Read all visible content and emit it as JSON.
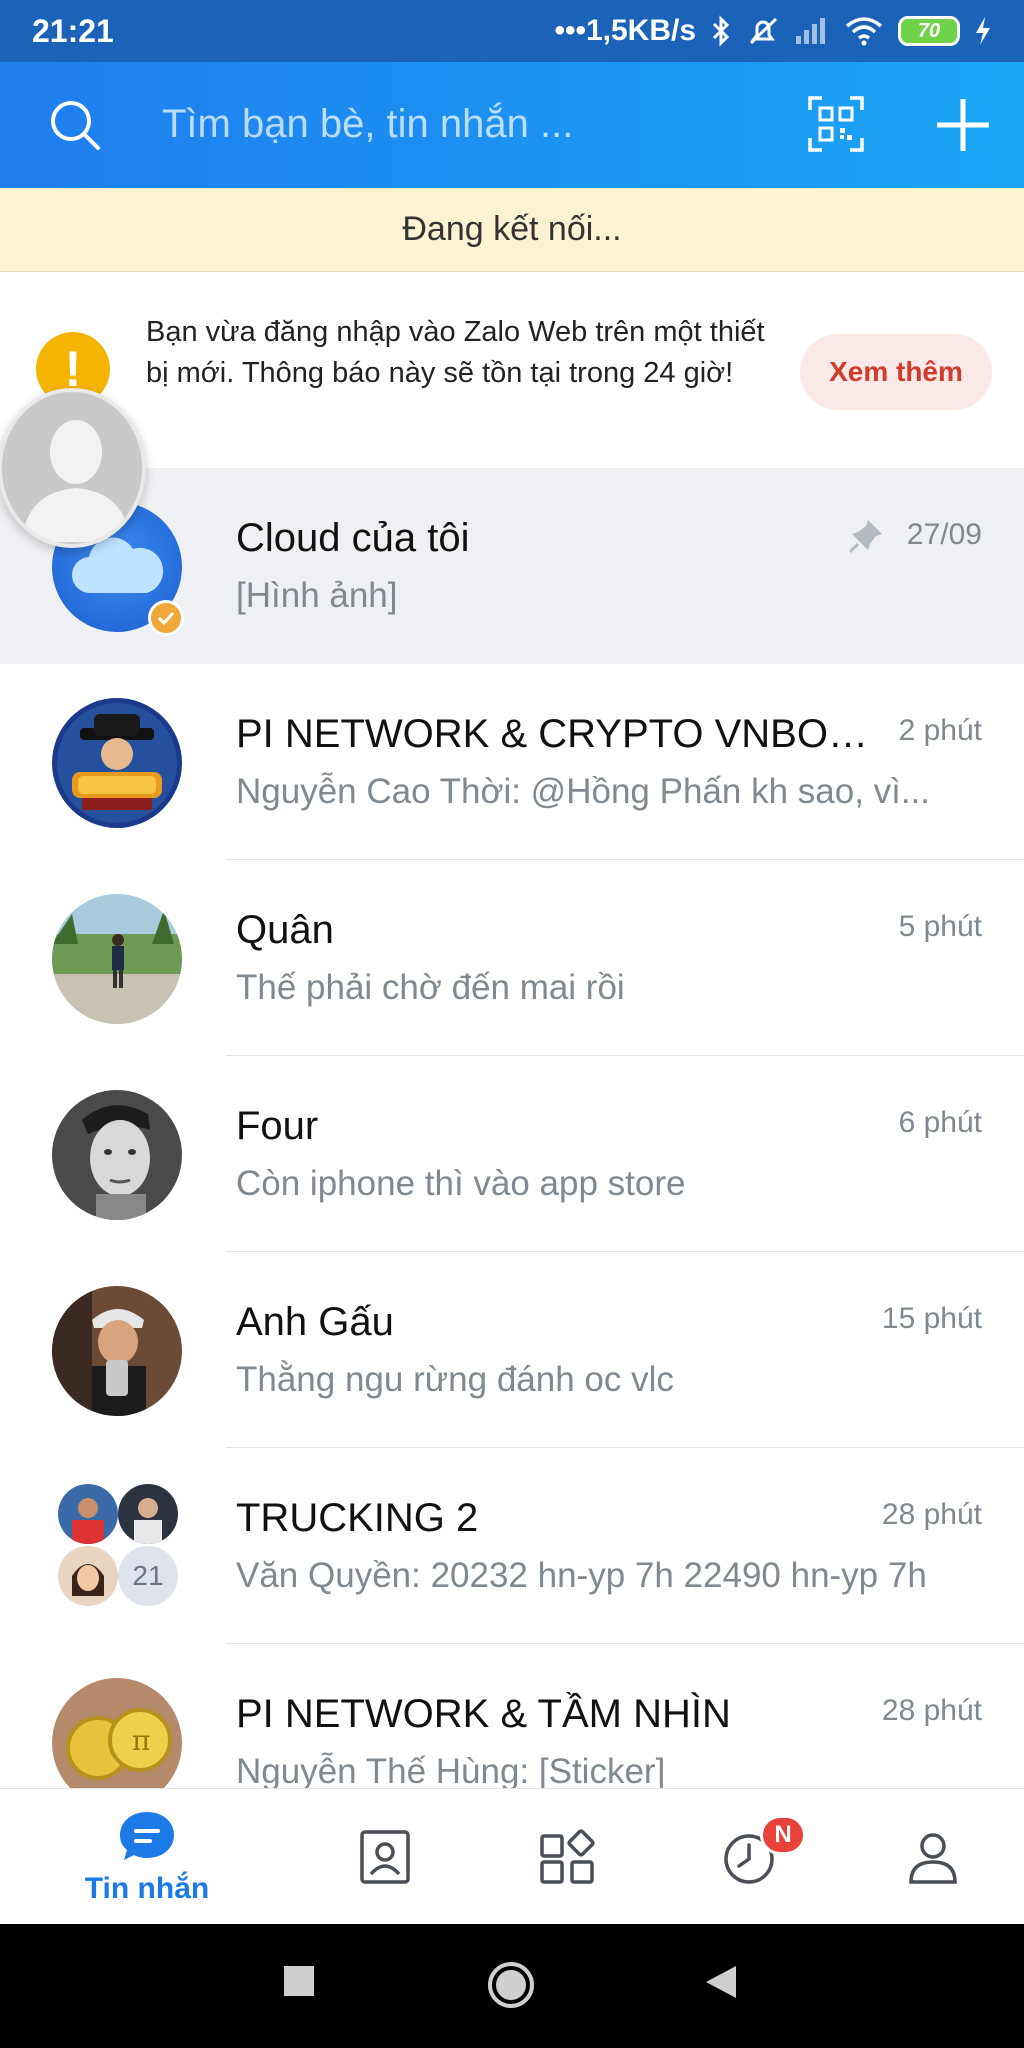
{
  "status_bar": {
    "time": "21:21",
    "network_speed": "•••1,5KB/s",
    "battery": "70"
  },
  "header": {
    "search_placeholder": "Tìm bạn bè, tin nhắn ..."
  },
  "connection_banner": {
    "text": "Đang kết nối..."
  },
  "login_notice": {
    "text": "Bạn vừa đăng nhập vào Zalo Web trên một thiết bị mới. Thông báo này sẽ tồn tại trong 24 giờ!",
    "button_label": "Xem thêm"
  },
  "chats": [
    {
      "name": "Cloud của tôi",
      "preview": "[Hình ảnh]",
      "time": "27/09",
      "pinned": true
    },
    {
      "name": "PI NETWORK & CRYPTO VNBOS...",
      "preview": "Nguyễn Cao Thời: @Hồng Phấn kh sao, vì...",
      "time": "2 phút"
    },
    {
      "name": "Quân",
      "preview": "Thế phải chờ đến mai rồi",
      "time": "5 phút"
    },
    {
      "name": "Four",
      "preview": "Còn iphone thì vào app store",
      "time": "6 phút"
    },
    {
      "name": "Anh Gấu",
      "preview": "Thằng ngu rừng đánh oc vlc",
      "time": "15 phút"
    },
    {
      "name": "TRUCKING 2",
      "preview": "Văn Quyền: 20232 hn-yp 7h 22490 hn-yp 7h",
      "time": "28 phút",
      "member_count": "21"
    },
    {
      "name": "PI NETWORK & TẦM NHÌN",
      "preview": "Nguyễn Thế Hùng: [Sticker]",
      "time": "28 phút"
    }
  ],
  "bottom_nav": {
    "messages_label": "Tin nhắn",
    "timeline_badge": "N"
  },
  "colors": {
    "accent": "#1b7ae6",
    "header_gradient_start": "#1f7dee",
    "header_gradient_end": "#1aa6f5",
    "banner_bg": "#fdf3d2",
    "notice_button_bg": "#fbe9e7",
    "notice_button_text": "#d23a2c",
    "badge_red": "#e8423a"
  },
  "icons": [
    "search-icon",
    "qr-code-icon",
    "plus-icon",
    "warning-icon",
    "pin-icon",
    "chat-bubble-icon",
    "contacts-icon",
    "apps-grid-icon",
    "clock-icon",
    "profile-icon"
  ]
}
